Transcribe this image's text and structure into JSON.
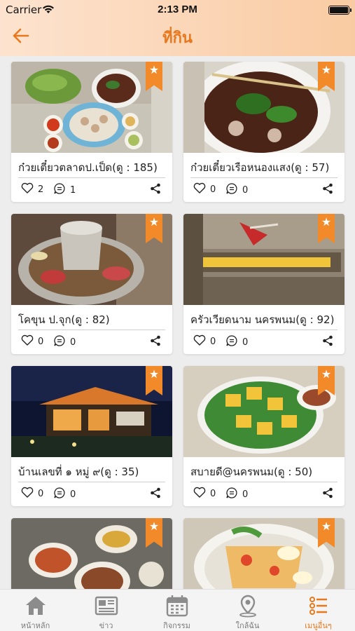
{
  "status_bar": {
    "carrier": "Carrier",
    "time": "2:13 PM"
  },
  "header": {
    "title": "ที่กิน"
  },
  "accent_color": "#e8781e",
  "places": [
    {
      "name": "ก๋วยเตี๋ยวตลาดป.เป็ด(ดู : 185)",
      "likes": "2",
      "comments": "1"
    },
    {
      "name": "ก๋วยเตี๋ยวเรือหนองแสง(ดู : 57)",
      "likes": "0",
      "comments": "0"
    },
    {
      "name": "โคขุน ป.จุก(ดู : 82)",
      "likes": "0",
      "comments": "0"
    },
    {
      "name": "ครัวเวียดนาม นครพนม(ดู : 92)",
      "likes": "0",
      "comments": "0"
    },
    {
      "name": "บ้านเลขที่ ๑ หมู่ ๙(ดู : 35)",
      "likes": "0",
      "comments": "0"
    },
    {
      "name": "สบายดี@นครพนม(ดู : 50)",
      "likes": "0",
      "comments": "0"
    },
    {
      "name": "",
      "likes": "",
      "comments": ""
    },
    {
      "name": "",
      "likes": "",
      "comments": ""
    }
  ],
  "tabs": [
    {
      "label": "หน้าหลัก",
      "icon": "home-icon"
    },
    {
      "label": "ข่าว",
      "icon": "newspaper-icon"
    },
    {
      "label": "กิจกรรม",
      "icon": "calendar-icon"
    },
    {
      "label": "ใกล้ฉัน",
      "icon": "location-pin-icon"
    },
    {
      "label": "เมนูอื่นๆ",
      "icon": "list-menu-icon"
    }
  ]
}
